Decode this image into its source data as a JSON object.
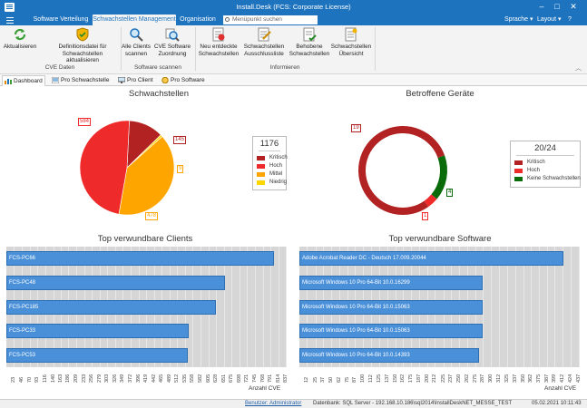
{
  "window": {
    "title": "Install.Desk (FCS: Corporate License)"
  },
  "menu": {
    "tabs": [
      "Software Verteilung",
      "Schwachstellen Management",
      "Organisation"
    ],
    "search_placeholder": "Menüpunkt suchen",
    "sprache": "Sprache",
    "layout": "Layout"
  },
  "ribbon": {
    "buttons": [
      {
        "label1": "Aktualisieren",
        "label2": ""
      },
      {
        "label1": "Definitionsdatei für",
        "label2": "Schwachstellen aktualisieren"
      },
      {
        "label1": "Alle Clients",
        "label2": "scannen"
      },
      {
        "label1": "CVE Software",
        "label2": "Zuordnung"
      },
      {
        "label1": "Neu entdeckte",
        "label2": "Schwachstellen"
      },
      {
        "label1": "Schwachstellen",
        "label2": "Ausschlussliste"
      },
      {
        "label1": "Behobene",
        "label2": "Schwachstellen"
      },
      {
        "label1": "Schwachstellen",
        "label2": "Übersicht"
      }
    ],
    "groups": [
      "CVE Daten",
      "Software scannen",
      "Informieren"
    ]
  },
  "doc_tabs": [
    "Dashboard",
    "Pro Schwachstelle",
    "Pro Client",
    "Pro Software"
  ],
  "colors": {
    "kritisch": "#b22222",
    "hoch": "#ee2a2a",
    "mittel": "#ffa500",
    "niedrig": "#ffd700",
    "keine": "#0a6b0a",
    "bar": "#4a90d9"
  },
  "panel_pie": {
    "title": "Schwachstellen",
    "total": "1176",
    "legend": [
      "Kritisch",
      "Hoch",
      "Mittel",
      "Niedrig"
    ],
    "labels": [
      "145",
      "584",
      "9",
      "478"
    ]
  },
  "panel_donut": {
    "title": "Betroffene Geräte",
    "total": "20/24",
    "legend": [
      "Kritisch",
      "Hoch",
      "Keine Schwachstellen"
    ],
    "labels": [
      "19",
      "1",
      "4"
    ]
  },
  "panel_clients": {
    "title": "Top verwundbare Clients",
    "xlabel": "Anzahl CVE",
    "ticks": [
      "23",
      "46",
      "70",
      "93",
      "116",
      "140",
      "163",
      "186",
      "209",
      "233",
      "256",
      "279",
      "303",
      "326",
      "349",
      "372",
      "396",
      "419",
      "442",
      "465",
      "489",
      "512",
      "535",
      "558",
      "582",
      "605",
      "628",
      "651",
      "675",
      "698",
      "721",
      "745",
      "768",
      "791",
      "814",
      "837"
    ]
  },
  "panel_software": {
    "title": "Top verwundbare Software",
    "xlabel": "Anzahl CVE",
    "ticks": [
      "12",
      "25",
      "37",
      "50",
      "62",
      "75",
      "87",
      "100",
      "112",
      "125",
      "137",
      "150",
      "162",
      "175",
      "187",
      "200",
      "212",
      "225",
      "237",
      "250",
      "262",
      "275",
      "287",
      "300",
      "312",
      "325",
      "337",
      "350",
      "362",
      "375",
      "387",
      "399",
      "412",
      "424",
      "437"
    ]
  },
  "chart_data": [
    {
      "type": "pie",
      "title": "Schwachstellen",
      "categories": [
        "Kritisch",
        "Hoch",
        "Mittel",
        "Niedrig"
      ],
      "values": [
        145,
        584,
        478,
        9
      ]
    },
    {
      "type": "pie",
      "title": "Betroffene Geräte",
      "categories": [
        "Kritisch",
        "Hoch",
        "Keine Schwachstellen"
      ],
      "values": [
        19,
        1,
        4
      ]
    },
    {
      "type": "bar",
      "title": "Top verwundbare Clients",
      "xlabel": "Anzahl CVE",
      "categories": [
        "FCS-PC66",
        "FCS-PC48",
        "FCS-PC185",
        "FCS-PC33",
        "FCS-PC53"
      ],
      "values": [
        803,
        655,
        629,
        547,
        543
      ],
      "xlim": [
        0,
        837
      ]
    },
    {
      "type": "bar",
      "title": "Top verwundbare Software",
      "xlabel": "Anzahl CVE",
      "categories": [
        "Adobe Acrobat Reader DC - Deutsch 17.009.20044",
        "Microsoft Windows 10 Pro 64-Bit 10.0.16299",
        "Microsoft Windows 10 Pro 64-Bit 10.0.15063",
        "Microsoft Windows 10 Pro 64-Bit 10.0.15063",
        "Microsoft Windows 10 Pro 64-Bit 10.0.14393"
      ],
      "values": [
        413,
        286,
        286,
        286,
        281
      ],
      "xlim": [
        0,
        437
      ]
    }
  ],
  "status": {
    "user": "Benutzer: Administrator",
    "db": "Datenbank: SQL Server - 192.168.10.186\\sql2014\\InstallDeskNET_MESSE_TEST",
    "datetime": "05.02.2021 10:11:43"
  }
}
